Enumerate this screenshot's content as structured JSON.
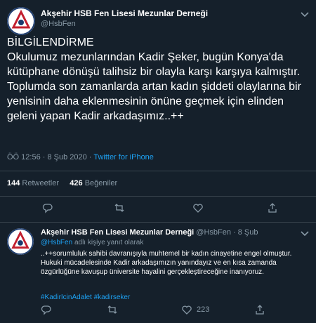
{
  "tweet": {
    "author_name": "Akşehir HSB Fen Lisesi Mezunlar Derneği",
    "author_handle": "@HsbFen",
    "text": "BİLGİLENDİRME\nOkulumuz mezunlarından Kadir Şeker, bugün Konya'da kütüphane dönüşü talihsiz bir olayla karşı karşıya kalmıştır.\nToplumda son zamanlarda artan kadın şiddeti olaylarına bir yenisinin daha eklenmesinin önüne geçmek için elinden geleni yapan Kadir arkadaşımız..++",
    "timestamp": "ÖÖ 12:56 · 8 Şub 2020 ·",
    "source": "Twitter for iPhone",
    "retweets_count": "144",
    "retweets_label": "Retweetler",
    "likes_count": "426",
    "likes_label": "Beğeniler"
  },
  "reply": {
    "author_name": "Akşehir HSB Fen Lisesi Mezunlar Derneği",
    "author_handle": "@HsbFen · 8 Şub",
    "replying_prefix": "@HsbFen",
    "replying_suffix": "adlı kişiye yanıt olarak",
    "text": "..++sorumluluk sahibi davranışıyla muhtemel bir kadın cinayetine engel olmuştur.\nHukuki mücadelesinde Kadir arkadaşımızın yanındayız ve en kısa zamanda özgürlüğüne kavuşup üniversite hayalini gerçekleştireceğine inanıyoruz.",
    "hashtags": "#KadirIcinAdalet  #kadirseker",
    "like_count": "223"
  },
  "icons": [
    "reply-icon",
    "retweet-icon",
    "like-icon",
    "share-icon",
    "chevron-down-icon"
  ],
  "colors": {
    "background": "#15202b",
    "accent": "#1da1f2",
    "muted": "#8899a6",
    "divider": "#38444d"
  }
}
